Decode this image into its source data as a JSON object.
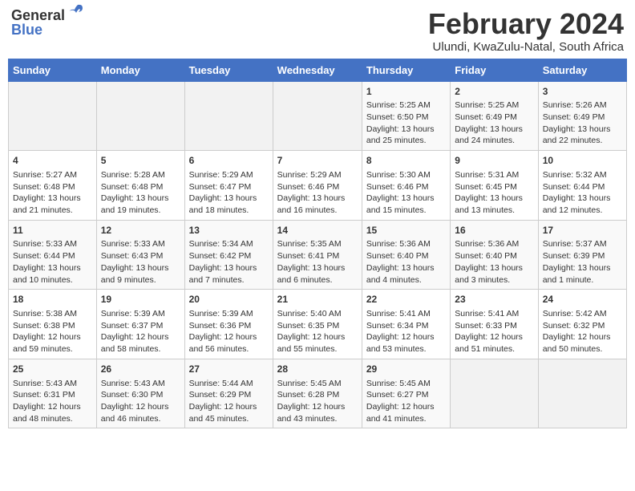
{
  "header": {
    "logo_general": "General",
    "logo_blue": "Blue",
    "title": "February 2024",
    "subtitle": "Ulundi, KwaZulu-Natal, South Africa"
  },
  "days_of_week": [
    "Sunday",
    "Monday",
    "Tuesday",
    "Wednesday",
    "Thursday",
    "Friday",
    "Saturday"
  ],
  "weeks": [
    [
      {
        "day": "",
        "content": ""
      },
      {
        "day": "",
        "content": ""
      },
      {
        "day": "",
        "content": ""
      },
      {
        "day": "",
        "content": ""
      },
      {
        "day": "1",
        "content": "Sunrise: 5:25 AM\nSunset: 6:50 PM\nDaylight: 13 hours and 25 minutes."
      },
      {
        "day": "2",
        "content": "Sunrise: 5:25 AM\nSunset: 6:49 PM\nDaylight: 13 hours and 24 minutes."
      },
      {
        "day": "3",
        "content": "Sunrise: 5:26 AM\nSunset: 6:49 PM\nDaylight: 13 hours and 22 minutes."
      }
    ],
    [
      {
        "day": "4",
        "content": "Sunrise: 5:27 AM\nSunset: 6:48 PM\nDaylight: 13 hours and 21 minutes."
      },
      {
        "day": "5",
        "content": "Sunrise: 5:28 AM\nSunset: 6:48 PM\nDaylight: 13 hours and 19 minutes."
      },
      {
        "day": "6",
        "content": "Sunrise: 5:29 AM\nSunset: 6:47 PM\nDaylight: 13 hours and 18 minutes."
      },
      {
        "day": "7",
        "content": "Sunrise: 5:29 AM\nSunset: 6:46 PM\nDaylight: 13 hours and 16 minutes."
      },
      {
        "day": "8",
        "content": "Sunrise: 5:30 AM\nSunset: 6:46 PM\nDaylight: 13 hours and 15 minutes."
      },
      {
        "day": "9",
        "content": "Sunrise: 5:31 AM\nSunset: 6:45 PM\nDaylight: 13 hours and 13 minutes."
      },
      {
        "day": "10",
        "content": "Sunrise: 5:32 AM\nSunset: 6:44 PM\nDaylight: 13 hours and 12 minutes."
      }
    ],
    [
      {
        "day": "11",
        "content": "Sunrise: 5:33 AM\nSunset: 6:44 PM\nDaylight: 13 hours and 10 minutes."
      },
      {
        "day": "12",
        "content": "Sunrise: 5:33 AM\nSunset: 6:43 PM\nDaylight: 13 hours and 9 minutes."
      },
      {
        "day": "13",
        "content": "Sunrise: 5:34 AM\nSunset: 6:42 PM\nDaylight: 13 hours and 7 minutes."
      },
      {
        "day": "14",
        "content": "Sunrise: 5:35 AM\nSunset: 6:41 PM\nDaylight: 13 hours and 6 minutes."
      },
      {
        "day": "15",
        "content": "Sunrise: 5:36 AM\nSunset: 6:40 PM\nDaylight: 13 hours and 4 minutes."
      },
      {
        "day": "16",
        "content": "Sunrise: 5:36 AM\nSunset: 6:40 PM\nDaylight: 13 hours and 3 minutes."
      },
      {
        "day": "17",
        "content": "Sunrise: 5:37 AM\nSunset: 6:39 PM\nDaylight: 13 hours and 1 minute."
      }
    ],
    [
      {
        "day": "18",
        "content": "Sunrise: 5:38 AM\nSunset: 6:38 PM\nDaylight: 12 hours and 59 minutes."
      },
      {
        "day": "19",
        "content": "Sunrise: 5:39 AM\nSunset: 6:37 PM\nDaylight: 12 hours and 58 minutes."
      },
      {
        "day": "20",
        "content": "Sunrise: 5:39 AM\nSunset: 6:36 PM\nDaylight: 12 hours and 56 minutes."
      },
      {
        "day": "21",
        "content": "Sunrise: 5:40 AM\nSunset: 6:35 PM\nDaylight: 12 hours and 55 minutes."
      },
      {
        "day": "22",
        "content": "Sunrise: 5:41 AM\nSunset: 6:34 PM\nDaylight: 12 hours and 53 minutes."
      },
      {
        "day": "23",
        "content": "Sunrise: 5:41 AM\nSunset: 6:33 PM\nDaylight: 12 hours and 51 minutes."
      },
      {
        "day": "24",
        "content": "Sunrise: 5:42 AM\nSunset: 6:32 PM\nDaylight: 12 hours and 50 minutes."
      }
    ],
    [
      {
        "day": "25",
        "content": "Sunrise: 5:43 AM\nSunset: 6:31 PM\nDaylight: 12 hours and 48 minutes."
      },
      {
        "day": "26",
        "content": "Sunrise: 5:43 AM\nSunset: 6:30 PM\nDaylight: 12 hours and 46 minutes."
      },
      {
        "day": "27",
        "content": "Sunrise: 5:44 AM\nSunset: 6:29 PM\nDaylight: 12 hours and 45 minutes."
      },
      {
        "day": "28",
        "content": "Sunrise: 5:45 AM\nSunset: 6:28 PM\nDaylight: 12 hours and 43 minutes."
      },
      {
        "day": "29",
        "content": "Sunrise: 5:45 AM\nSunset: 6:27 PM\nDaylight: 12 hours and 41 minutes."
      },
      {
        "day": "",
        "content": ""
      },
      {
        "day": "",
        "content": ""
      }
    ]
  ]
}
